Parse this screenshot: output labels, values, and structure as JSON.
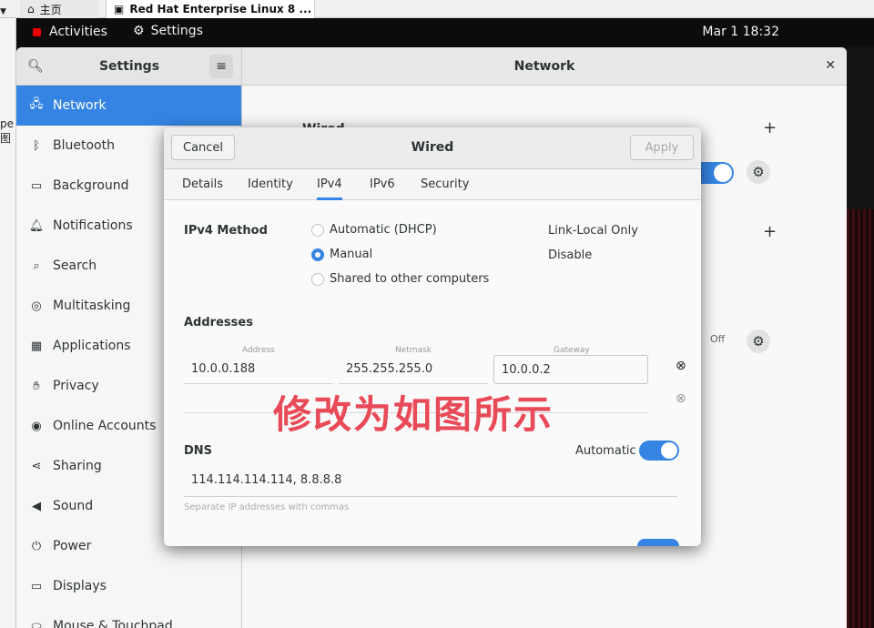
{
  "host": {
    "tabs": [
      {
        "label": "主页",
        "icon": "home-icon"
      },
      {
        "label": "Red Hat Enterprise Linux 8 ...",
        "icon": "vm-icon"
      }
    ],
    "side_text": "pe\n图"
  },
  "top_bar": {
    "activities": "Activities",
    "app_menu": "Settings",
    "clock": "Mar 1  18:32"
  },
  "settings": {
    "sidebar_title": "Settings",
    "page_title": "Network",
    "sidebar_items": [
      {
        "label": "Network",
        "icon": "network-icon",
        "active": true
      },
      {
        "label": "Bluetooth",
        "icon": "bluetooth-icon"
      },
      {
        "label": "Background",
        "icon": "background-icon"
      },
      {
        "label": "Notifications",
        "icon": "bell-icon"
      },
      {
        "label": "Search",
        "icon": "search-icon"
      },
      {
        "label": "Multitasking",
        "icon": "multitasking-icon"
      },
      {
        "label": "Applications",
        "icon": "grid-icon"
      },
      {
        "label": "Privacy",
        "icon": "hand-icon"
      },
      {
        "label": "Online Accounts",
        "icon": "online-accounts-icon"
      },
      {
        "label": "Sharing",
        "icon": "share-icon"
      },
      {
        "label": "Sound",
        "icon": "speaker-icon"
      },
      {
        "label": "Power",
        "icon": "power-icon"
      },
      {
        "label": "Displays",
        "icon": "display-icon"
      },
      {
        "label": "Mouse & Touchpad",
        "icon": "mouse-icon"
      }
    ],
    "main": {
      "wired_heading": "Wired",
      "off_label": "Off"
    }
  },
  "dialog": {
    "cancel": "Cancel",
    "title": "Wired",
    "apply": "Apply",
    "tabs": [
      "Details",
      "Identity",
      "IPv4",
      "IPv6",
      "Security"
    ],
    "active_tab": "IPv4",
    "ipv4_method_label": "IPv4 Method",
    "methods": {
      "automatic": "Automatic (DHCP)",
      "manual": "Manual",
      "shared": "Shared to other computers",
      "link_local": "Link-Local Only",
      "disable": "Disable"
    },
    "selected_method": "Manual",
    "addresses_label": "Addresses",
    "address_columns": [
      "Address",
      "Netmask",
      "Gateway"
    ],
    "address_row": {
      "address": "10.0.0.188",
      "netmask": "255.255.255.0",
      "gateway": "10.0.0.2"
    },
    "annotation": "修改为如图所示",
    "dns_label": "DNS",
    "dns_automatic_label": "Automatic",
    "dns_automatic_on": true,
    "dns_value": "114.114.114.114, 8.8.8.8",
    "dns_hint": "Separate IP addresses with commas"
  },
  "colors": {
    "accent": "#3584e4",
    "annotation": "#e84a57",
    "redhat": "#ee0000"
  }
}
